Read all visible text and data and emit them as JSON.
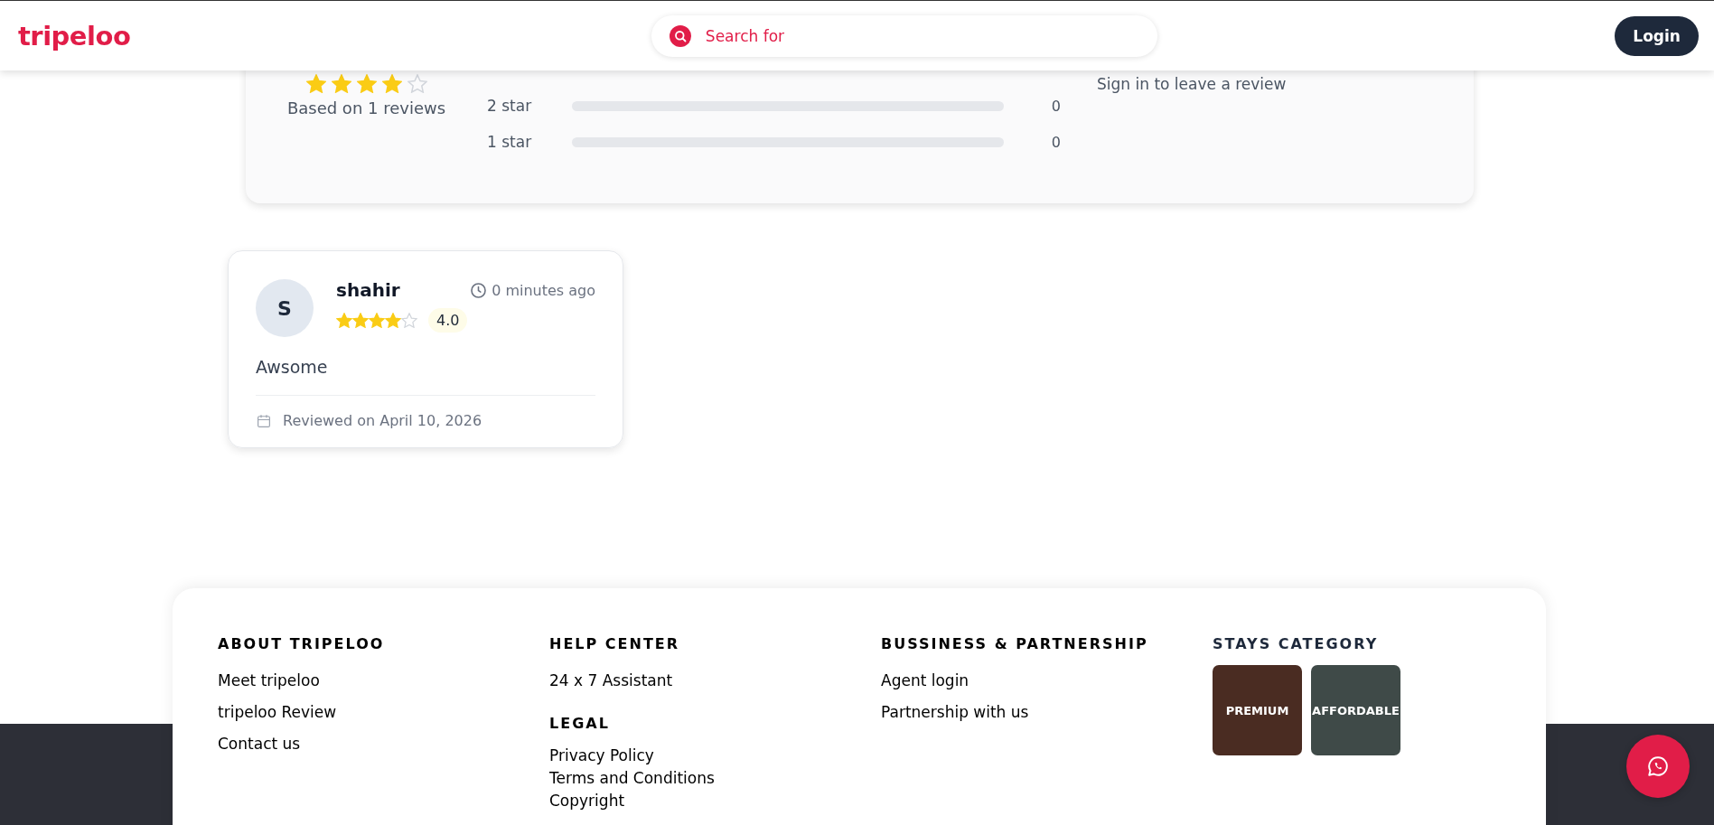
{
  "header": {
    "logo": "tripeloo",
    "search": {
      "placeholder": "Search for"
    },
    "login_button": "Login"
  },
  "rating_summary": {
    "stars": 4,
    "caption": "Based on 1 reviews",
    "sign_in_note": "Sign in to leave a review",
    "bars": [
      {
        "label": "2 star",
        "level": 0,
        "count": "0"
      },
      {
        "label": "1 star",
        "level": 0,
        "count": "0"
      }
    ]
  },
  "reviews": [
    {
      "avatar_initial": "S",
      "name": "shahir",
      "time": "0 minutes ago",
      "stars": 4,
      "rating": "4.0",
      "text": "Awsome",
      "date": "Reviewed on April 10, 2026"
    }
  ],
  "footer": {
    "columns": [
      {
        "sections": [
          {
            "kind": "links",
            "heading": "ABOUT TRIPELOO",
            "items": [
              "Meet tripeloo",
              "tripeloo Review",
              "Contact us"
            ]
          }
        ]
      },
      {
        "sections": [
          {
            "kind": "links",
            "heading": "HELP CENTER",
            "items": [
              "24 x 7 Assistant"
            ]
          },
          {
            "kind": "compact",
            "heading": "LEGAL",
            "items": [
              "Privacy Policy",
              "Terms and Conditions",
              "Copyright"
            ]
          }
        ]
      },
      {
        "sections": [
          {
            "kind": "links",
            "heading": "BUSSINESS & PARTNERSHIP",
            "items": [
              "Agent login",
              "Partnership with us"
            ]
          }
        ]
      },
      {
        "sections": [
          {
            "kind": "tiles",
            "heading": "STAYS CATEGORY",
            "items": [
              "PREMIUM",
              "AFFORDABLE"
            ]
          }
        ]
      }
    ]
  }
}
